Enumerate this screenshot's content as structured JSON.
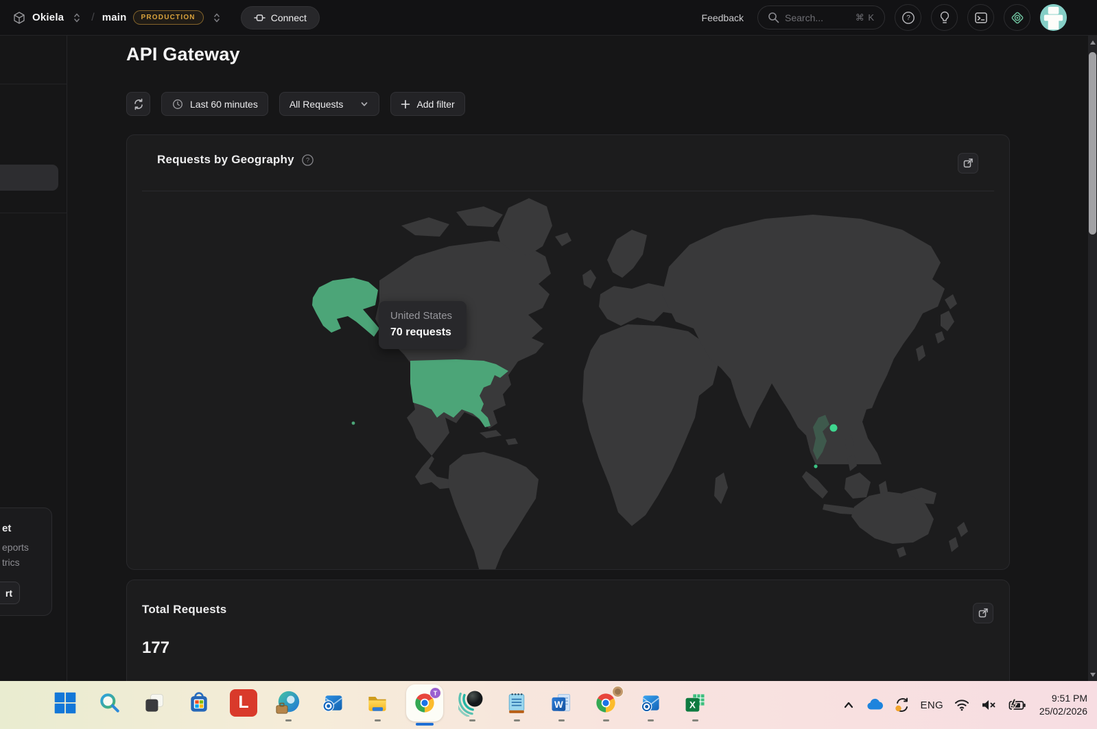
{
  "topbar": {
    "app_name": "Okiela",
    "path_separator": "/",
    "branch_name": "main",
    "env_badge": "PRODUCTION",
    "connect_label": "Connect",
    "feedback_label": "Feedback",
    "search_placeholder": "Search...",
    "search_shortcut_mod": "⌘",
    "search_shortcut_key": "K",
    "help_glyph": "?"
  },
  "page": {
    "title": "API Gateway",
    "toolbar": {
      "time_range_label": "Last 60 minutes",
      "request_filter_label": "All Requests",
      "add_filter_label": "Add filter"
    }
  },
  "geography_card": {
    "title": "Requests by Geography",
    "help_glyph": "?",
    "tooltip_country": "United States",
    "tooltip_value": "70 requests",
    "map_data": {
      "highlighted_regions": [
        {
          "name": "United States",
          "requests": 70,
          "color": "#4CA578"
        }
      ],
      "markers": [
        {
          "region": "East Asia",
          "size": "large"
        },
        {
          "region": "Southeast Asia",
          "size": "small"
        }
      ]
    }
  },
  "totals_card": {
    "title": "Total Requests",
    "value": "177"
  },
  "sidebar": {
    "promo_line_1": "et",
    "promo_line_2": "eports",
    "promo_line_3": "trics",
    "promo_button_label": "rt"
  },
  "taskbar": {
    "language_label": "ENG",
    "clock_time": "9:51 PM",
    "clock_date": "25/02/2026",
    "icon_letters": {
      "l_app": "L",
      "chrome_profile": "T",
      "word": "W",
      "excel": "X"
    }
  },
  "colors": {
    "accent_green": "#4CA578",
    "marker_green": "#3FD68F",
    "badge_orange": "#D9A23C"
  }
}
